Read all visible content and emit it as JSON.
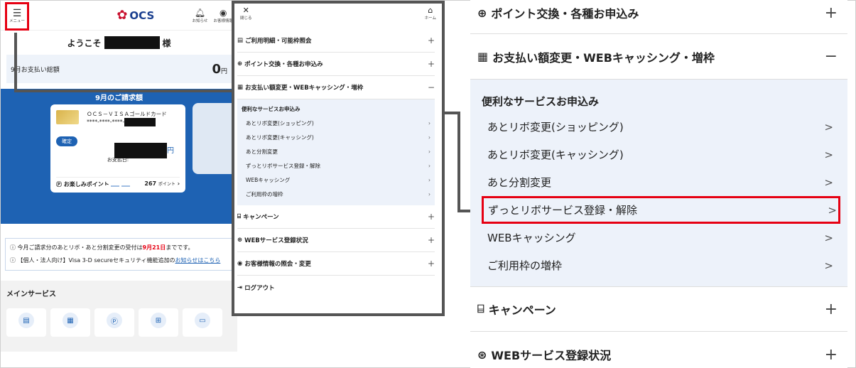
{
  "phone": {
    "menu_label": "メニュー",
    "logo": "OCS",
    "logo_sub": "BANK OF THE RYUKYUS GROUP",
    "notice_label": "お知らせ",
    "account_label": "お客様情報",
    "welcome_prefix": "ようこそ",
    "welcome_suffix": "様",
    "pay_label": "9月お支払い総額",
    "pay_amount": "0",
    "pay_unit": "円",
    "bill_title": "9月のご請求額",
    "card_name": "ＯＣＳ－ＶＩＳＡゴールドカード",
    "card_number": "****-****-****-",
    "confirmed": "確定",
    "yen": "円",
    "pay_date": "お支払日:",
    "points_label": "お楽しみポイント",
    "points_value": "267",
    "points_unit": "ポイント",
    "notice1_a": "今月ご請求分のあとリボ・あと分割変更の受付は",
    "notice1_date": "9月21日",
    "notice1_b": "までです。",
    "notice2_a": "【個人・法人向け】Visa 3-D secureセキュリティ機能追加の",
    "notice2_link": "お知らせはこちら",
    "main_services": "メインサービス"
  },
  "menu": {
    "close": "閉じる",
    "home": "ホーム",
    "items": [
      {
        "label": "ご利用明細・可能枠照会",
        "sign": "+"
      },
      {
        "label": "ポイント交換・各種お申込み",
        "sign": "+"
      },
      {
        "label": "お支払い額変更・WEBキャッシング・増枠",
        "sign": "−"
      }
    ],
    "sub_title": "便利なサービスお申込み",
    "sub_items": [
      "あとリボ変更(ショッピング)",
      "あとリボ変更(キャッシング)",
      "あと分割変更",
      "ずっとリボサービス登録・解除",
      "WEBキャッシング",
      "ご利用枠の増枠"
    ],
    "items2": [
      {
        "label": "キャンペーン",
        "sign": "+"
      },
      {
        "label": "WEBサービス登録状況",
        "sign": "+"
      },
      {
        "label": "お客様情報の照会・変更",
        "sign": "+"
      }
    ],
    "logout": "ログアウト"
  },
  "zoom": {
    "row1": "ポイント交換・各種お申込み",
    "row2": "お支払い額変更・WEBキャッシング・増枠",
    "sub_title": "便利なサービスお申込み",
    "sub_items": [
      "あとリボ変更(ショッピング)",
      "あとリボ変更(キャッシング)",
      "あと分割変更",
      "ずっとリボサービス登録・解除",
      "WEBキャッシング",
      "ご利用枠の増枠"
    ],
    "row3": "キャンペーン",
    "row4": "WEBサービス登録状況",
    "plus": "+",
    "minus": "−",
    "chevron": ">"
  }
}
